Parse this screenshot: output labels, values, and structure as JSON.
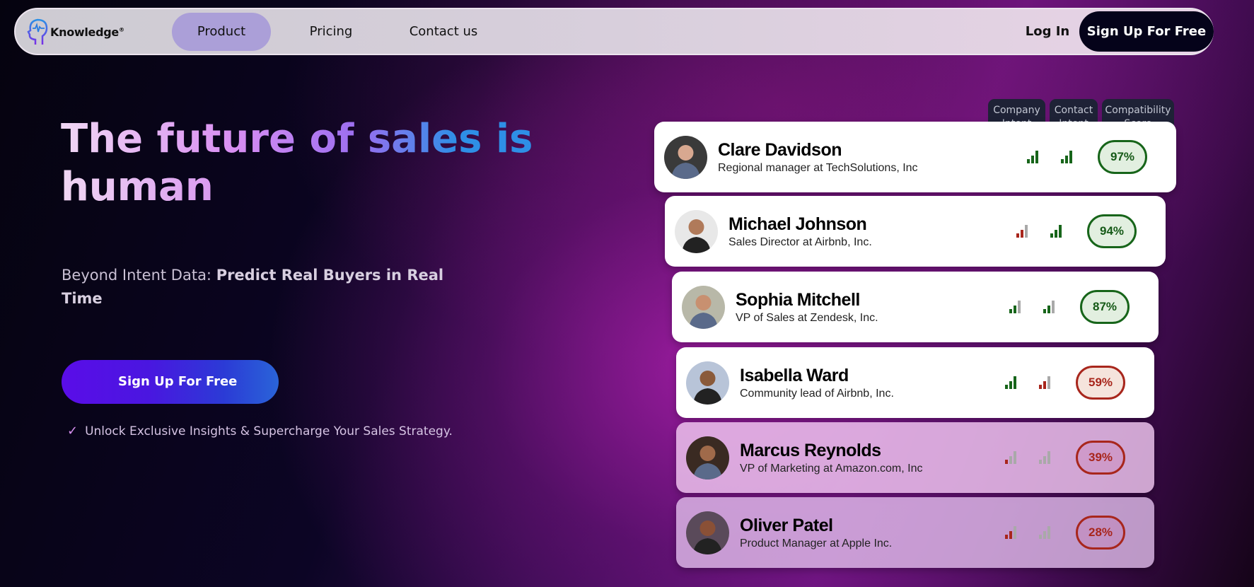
{
  "nav": {
    "logo": "Knowledge",
    "links": [
      "Product",
      "Pricing",
      "Contact us"
    ],
    "active": "Product",
    "login": "Log In",
    "signup": "Sign Up For Free"
  },
  "hero": {
    "title_line1": "The future of sales is",
    "title_line2": "human",
    "subtitle_plain": "Beyond Intent Data: ",
    "subtitle_bold": "Predict Real Buyers in Real Time",
    "cta": "Sign Up For Free",
    "benefit": "Unlock Exclusive Insights & Supercharge Your Sales Strategy."
  },
  "columns": {
    "company_intent": "Company Intent",
    "contact_intent": "Contact Intent",
    "score": "Compatibility Score"
  },
  "colors": {
    "good": "#17651a",
    "bad": "#a8261c",
    "inactive": "#a9a9a9"
  },
  "leads": [
    {
      "name": "Clare Davidson",
      "role": "Regional manager at TechSolutions, Inc",
      "company_intent": 3,
      "company_color": "good",
      "contact_intent": 3,
      "contact_color": "good",
      "score": "97%",
      "status": "good"
    },
    {
      "name": "Michael Johnson",
      "role": "Sales Director at Airbnb, Inc.",
      "company_intent": 2,
      "company_color": "bad",
      "contact_intent": 3,
      "contact_color": "good",
      "score": "94%",
      "status": "good"
    },
    {
      "name": "Sophia Mitchell",
      "role": "VP of Sales at Zendesk, Inc.",
      "company_intent": 2,
      "company_color": "good",
      "contact_intent": 2,
      "contact_color": "good",
      "score": "87%",
      "status": "good"
    },
    {
      "name": "Isabella Ward",
      "role": "Community lead of Airbnb, Inc.",
      "company_intent": 3,
      "company_color": "good",
      "contact_intent": 2,
      "contact_color": "bad",
      "score": "59%",
      "status": "bad"
    },
    {
      "name": "Marcus Reynolds",
      "role": "VP of Marketing at Amazon.com, Inc",
      "company_intent": 1,
      "company_color": "bad",
      "contact_intent": 0,
      "contact_color": "bad",
      "score": "39%",
      "status": "bad"
    },
    {
      "name": "Oliver Patel",
      "role": "Product Manager at Apple Inc.",
      "company_intent": 2,
      "company_color": "bad",
      "contact_intent": 0,
      "contact_color": "bad",
      "score": "28%",
      "status": "bad"
    }
  ]
}
